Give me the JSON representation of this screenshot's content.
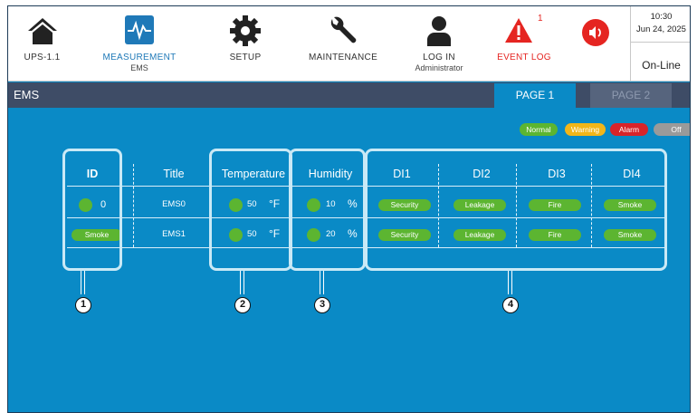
{
  "topbar": {
    "ups": {
      "label": "UPS-1.1",
      "icon": "home-icon"
    },
    "measurement": {
      "label": "MEASUREMENT",
      "sub": "EMS",
      "icon": "waveform-icon"
    },
    "setup": {
      "label": "SETUP",
      "icon": "gear-icon"
    },
    "maintenance": {
      "label": "MAINTENANCE",
      "icon": "wrench-icon"
    },
    "login": {
      "label": "LOG IN",
      "sub": "Administrator",
      "icon": "user-icon"
    },
    "event_log": {
      "label": "EVENT LOG",
      "icon": "warning-icon",
      "badge": "1"
    },
    "speaker": {
      "icon": "speaker-icon"
    },
    "clock": {
      "time": "10:30",
      "date": "Jun 24, 2025",
      "status": "On-Line"
    }
  },
  "page": {
    "title": "EMS",
    "tabs": [
      {
        "label": "PAGE 1",
        "active": true
      },
      {
        "label": "PAGE 2",
        "active": false
      }
    ]
  },
  "legend": {
    "normal": "Normal",
    "warning": "Warning",
    "alarm": "Alarm",
    "off": "Off"
  },
  "colors": {
    "normal": "#5cb531",
    "warning": "#f3b619",
    "alarm": "#d8242a",
    "off": "#9a9a9a",
    "accent": "#0a8ac6",
    "header": "#3e4c66"
  },
  "table": {
    "headers": {
      "id": "ID",
      "title": "Title",
      "temperature": "Temperature",
      "humidity": "Humidity",
      "di1": "DI1",
      "di2": "DI2",
      "di3": "DI3",
      "di4": "DI4"
    },
    "rows": [
      {
        "id": "0",
        "title": "EMS0",
        "temp": "50",
        "temp_unit": "°F",
        "hum": "10",
        "hum_unit": "%",
        "di1": "Security",
        "di2": "Leakage",
        "di3": "Fire",
        "di4": "Smoke"
      },
      {
        "id": "Smoke",
        "title": "EMS1",
        "temp": "50",
        "temp_unit": "°F",
        "hum": "20",
        "hum_unit": "%",
        "di1": "Security",
        "di2": "Leakage",
        "di3": "Fire",
        "di4": "Smoke"
      }
    ]
  },
  "callouts": [
    "1",
    "2",
    "3",
    "4"
  ]
}
